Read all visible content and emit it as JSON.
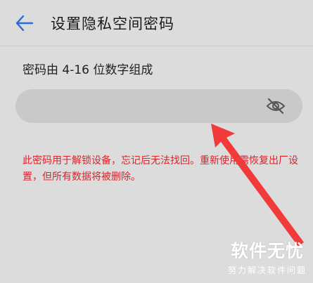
{
  "header": {
    "title": "设置隐私空间密码",
    "back_icon": "arrow-left-icon"
  },
  "colors": {
    "accent": "#2b6bd6",
    "warning": "#d9242c",
    "background": "#dcdcdc",
    "input_background": "#c9c9c9",
    "annotation_arrow": "#f13a3a"
  },
  "form": {
    "hint": "密码由 4-16 位数字组成",
    "password_value": "",
    "visibility_icon": "eye-off-icon",
    "warning": "此密码用于解锁设备，忘记后无法找回。重新使用需恢复出厂设置，但所有数据将被删除。"
  },
  "watermark": {
    "main": "软件无忧",
    "sub": "努力解决软件问题"
  }
}
